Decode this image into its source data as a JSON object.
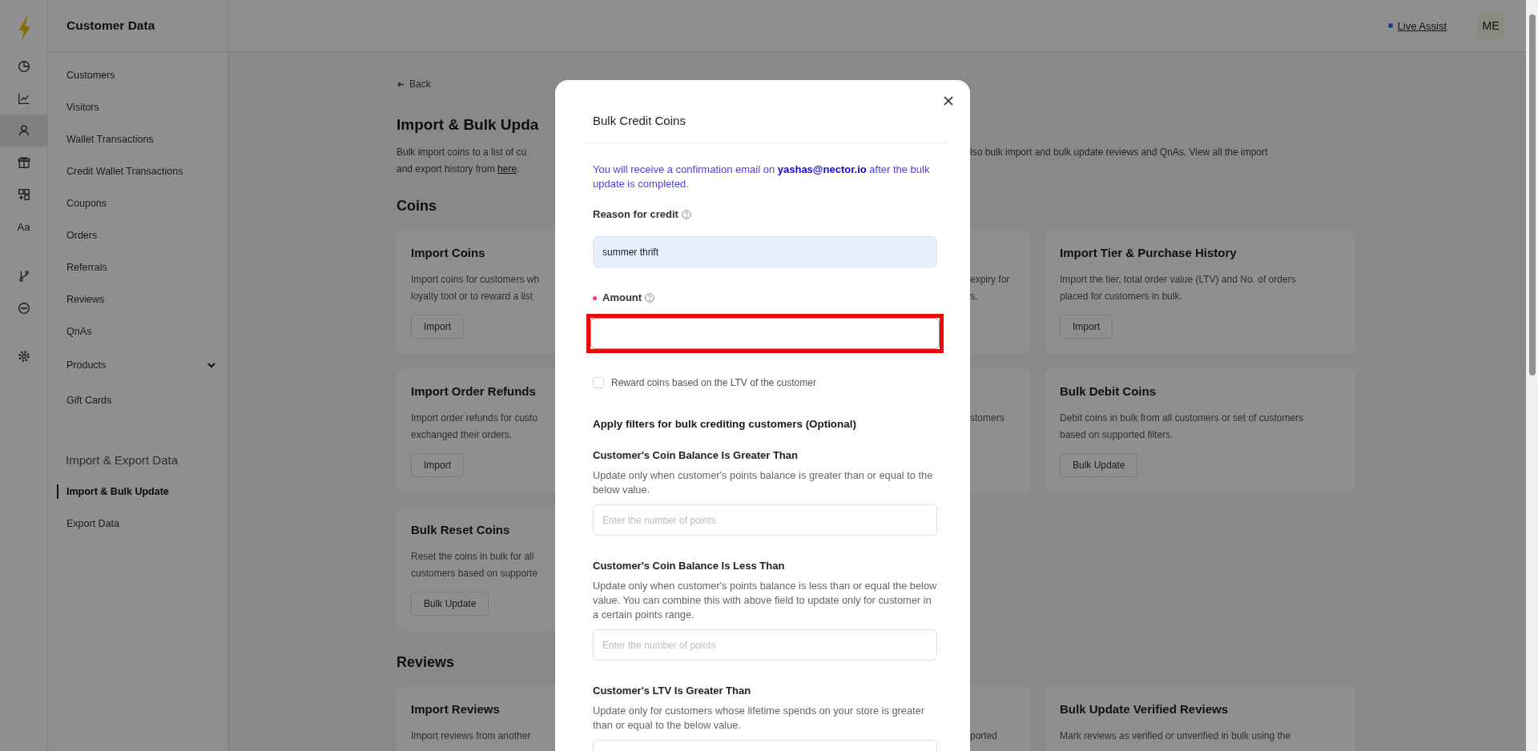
{
  "rail": {
    "groups": [
      {
        "items": [
          {
            "kind": "icon",
            "selected": false
          },
          {
            "kind": "icon",
            "selected": false
          },
          {
            "kind": "icon",
            "selected": true
          },
          {
            "kind": "icon",
            "selected": false
          },
          {
            "kind": "icon",
            "selected": false
          },
          {
            "kind": "text",
            "text": "Aa",
            "selected": false
          }
        ]
      },
      {
        "items": [
          {
            "kind": "icon",
            "selected": false
          },
          {
            "kind": "icon",
            "selected": false
          }
        ]
      },
      {
        "items": [
          {
            "kind": "icon",
            "selected": false
          }
        ]
      }
    ]
  },
  "nav": {
    "title": "Customer Data",
    "sections": [
      {
        "items": [
          {
            "label": "Customers",
            "kind": "link",
            "selected": false
          },
          {
            "label": "Visitors",
            "kind": "link",
            "selected": false
          },
          {
            "label": "Wallet Transactions",
            "kind": "link",
            "selected": false
          },
          {
            "label": "Credit Wallet Transactions",
            "kind": "link",
            "selected": false
          },
          {
            "label": "Coupons",
            "kind": "link",
            "selected": false
          },
          {
            "label": "Orders",
            "kind": "link",
            "selected": false
          },
          {
            "label": "Referrals",
            "kind": "link",
            "selected": false
          },
          {
            "label": "Reviews",
            "kind": "link",
            "selected": false
          },
          {
            "label": "QnAs",
            "kind": "link",
            "selected": false
          },
          {
            "label": "Products",
            "kind": "group",
            "selected": false
          },
          {
            "label": "Gift Cards",
            "kind": "link",
            "selected": false
          }
        ]
      },
      {
        "heading": "Import & Export Data",
        "items": [
          {
            "label": "Import & Bulk Update",
            "kind": "link",
            "selected": true
          },
          {
            "label": "Export Data",
            "kind": "link",
            "selected": false
          }
        ]
      }
    ]
  },
  "header": {
    "live_assist": "Live Assist",
    "avatar": "ME"
  },
  "page": {
    "back": "Back",
    "title": "Import & Bulk Upda",
    "description": {
      "left_lines": [
        "Bulk import coins to a list of cu",
        "and export history from "
      ],
      "link": "here",
      "end": ".",
      "right_fragment": "lso bulk import and bulk update reviews and QnAs. View all the import"
    },
    "sections": [
      {
        "heading": "Coins",
        "rows": [
          {
            "left": {
              "title": "Import Coins",
              "lines": [
                "Import coins for customers wh",
                "loyalty tool or to reward a list"
              ],
              "button": "Import"
            },
            "middle": {
              "lines": [
                "expiry for",
                "s."
              ]
            },
            "right": {
              "title": "Import Tier & Purchase History",
              "lines": [
                "Import the tier, total order value (LTV) and No. of orders",
                "placed for customers in bulk."
              ],
              "button": "Import"
            }
          },
          {
            "left": {
              "title": "Import Order Refunds",
              "lines": [
                "Import order refunds for custo",
                "exchanged their orders."
              ],
              "button": "Import"
            },
            "middle": {
              "lines": [
                "stomers"
              ]
            },
            "right": {
              "title": "Bulk Debit Coins",
              "lines": [
                "Debit coins in bulk from all customers or set of customers",
                "based on supported filters."
              ],
              "button": "Bulk Update"
            }
          },
          {
            "left": {
              "title": "Bulk Reset Coins",
              "lines": [
                "Reset the coins in bulk for all",
                "customers based on supporte"
              ],
              "button": "Bulk Update"
            }
          }
        ]
      },
      {
        "heading": "Reviews",
        "rows": [
          {
            "left": {
              "title": "Import Reviews",
              "lines": [
                "Import reviews from another"
              ]
            },
            "middle": {
              "lines": [
                "ported"
              ]
            },
            "right": {
              "title": "Bulk Update Verified Reviews",
              "lines": [
                "Mark reviews as verified or unverified in bulk using the"
              ]
            }
          }
        ]
      }
    ]
  },
  "modal": {
    "title": "Bulk Credit Coins",
    "info": "You will receive a confirmation email on **yashas@nector.io** after the bulk update is completed.",
    "fields": [
      {
        "label": "Reason for credit",
        "required": false,
        "help": true,
        "autofilled": true,
        "marked": false,
        "value": "summer thrift"
      },
      {
        "label": "Amount",
        "required": true,
        "help": true,
        "autofilled": false,
        "marked": true
      }
    ],
    "checkbox": {
      "label": "Reward coins based on the LTV of the customer",
      "checked": false
    },
    "filters_heading": "Apply filters for bulk crediting customers (Optional)",
    "filters": [
      {
        "title": "Customer's Coin Balance Is Greater Than",
        "description": "Update only when customer's points balance is greater than or equal to the below value.",
        "placeholder": "Enter the number of points"
      },
      {
        "title": "Customer's Coin Balance Is Less Than",
        "description": "Update only when customer's points balance is less than or equal the below value. You can combine this with above field to update only for customer in a certain points range.",
        "placeholder": "Enter the number of points"
      },
      {
        "title": "Customer's LTV Is Greater Than",
        "description": "Update only for customers whose lifetime spends on your store is greater than or equal to the below value."
      }
    ]
  }
}
